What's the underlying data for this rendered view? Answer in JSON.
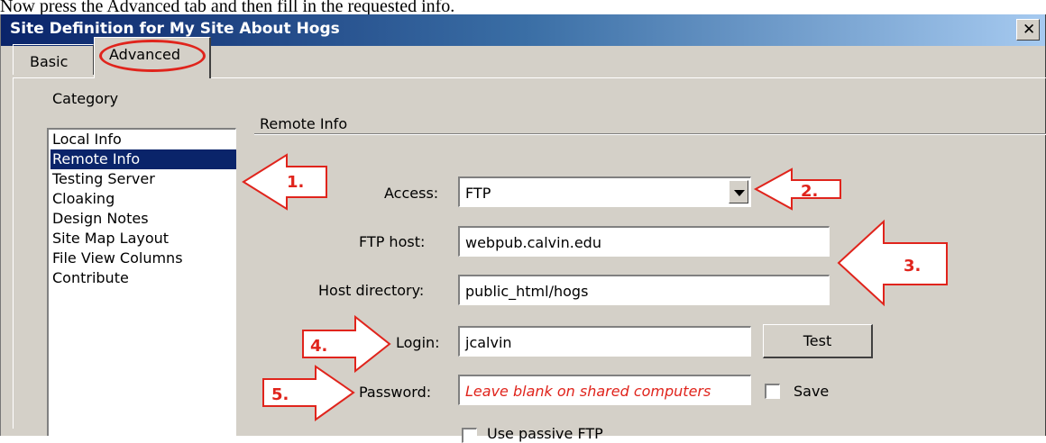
{
  "caption": "Now press the Advanced tab and then fill in the requested info.",
  "window": {
    "title": "Site Definition for My Site About Hogs",
    "close_glyph": "✕"
  },
  "tabs": {
    "basic": "Basic",
    "advanced": "Advanced"
  },
  "category": {
    "heading": "Category",
    "items": [
      "Local Info",
      "Remote Info",
      "Testing Server",
      "Cloaking",
      "Design Notes",
      "Site Map Layout",
      "File View Columns",
      "Contribute"
    ],
    "selected": "Remote Info"
  },
  "section_title": "Remote Info",
  "form": {
    "access_label": "Access:",
    "access_value": "FTP",
    "ftp_host_label": "FTP host:",
    "ftp_host_value": "webpub.calvin.edu",
    "host_dir_label": "Host directory:",
    "host_dir_value": "public_html/hogs",
    "login_label": "Login:",
    "login_value": "jcalvin",
    "password_label": "Password:",
    "password_value": "Leave blank on shared computers",
    "test_button": "Test",
    "save_label": "Save",
    "passive_label": "Use passive FTP"
  },
  "callouts": [
    "1.",
    "2.",
    "3.",
    "4.",
    "5."
  ],
  "colors": {
    "annotation": "#e0241c",
    "selection": "#0a246a",
    "dialog": "#d4d0c8"
  }
}
